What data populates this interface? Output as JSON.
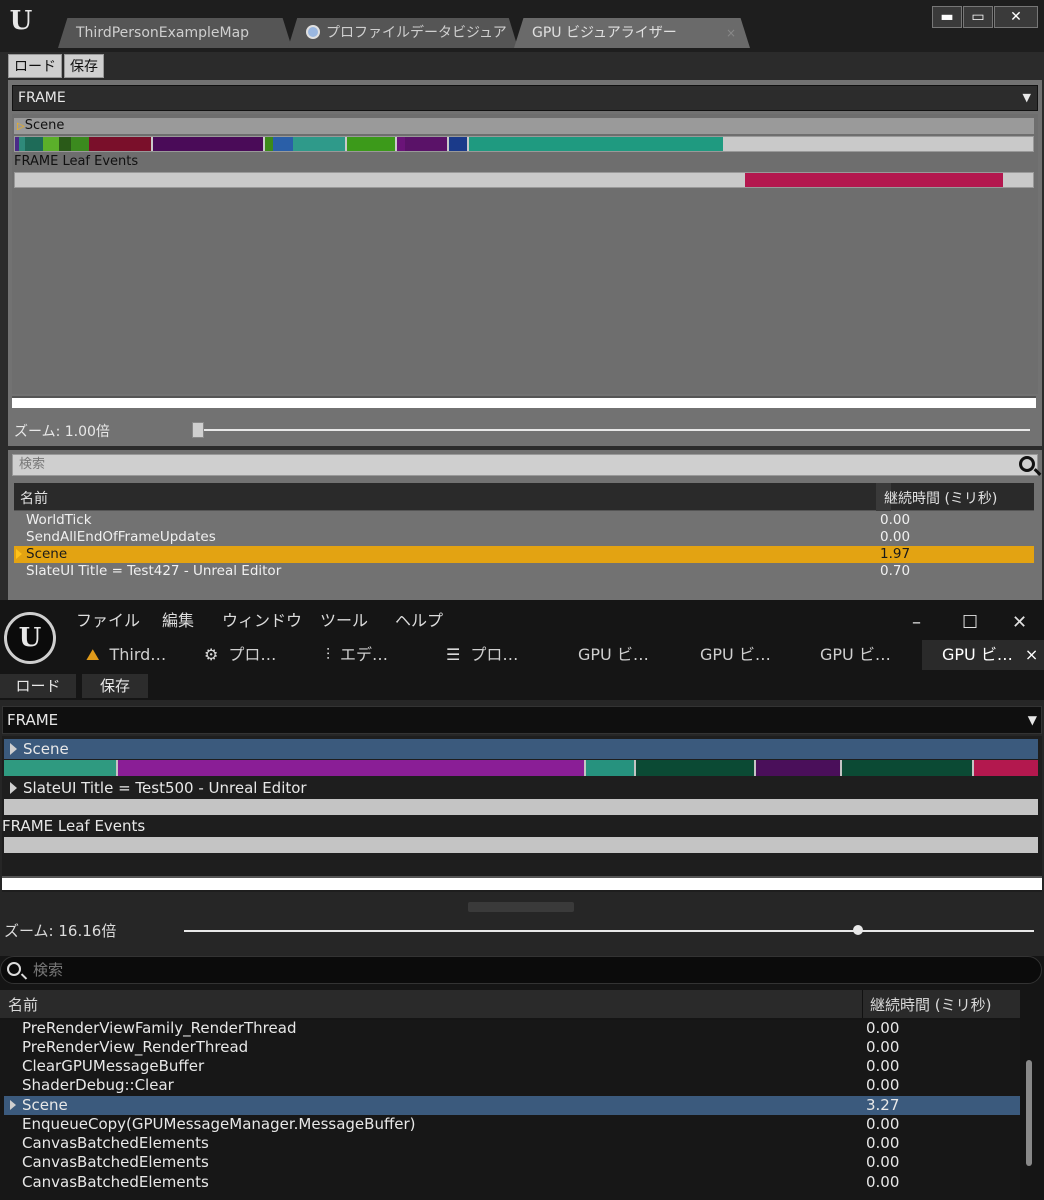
{
  "top_window": {
    "tabs": [
      {
        "label": "ThirdPersonExampleMap"
      },
      {
        "label": "プロファイルデータビジュア"
      },
      {
        "label": "GPU ビジュアライザー",
        "close": "×"
      }
    ],
    "window_controls": {
      "minimize": "▬",
      "maximize": "▭",
      "close": "✕"
    },
    "toolbar": {
      "load": "ロード",
      "save": "保存"
    },
    "frame_combo": "FRAME",
    "graph": {
      "row1_label": "Scene",
      "row2_label": "FRAME Leaf Events"
    },
    "zoom_label": "ズーム: 1.00倍",
    "zoom_value": 0.0,
    "search_placeholder": "検索",
    "table": {
      "headers": [
        "名前",
        "継続時間 (ミリ秒)"
      ],
      "rows": [
        {
          "name": "WorldTick",
          "value": "0.00"
        },
        {
          "name": "SendAllEndOfFrameUpdates",
          "value": "0.00"
        },
        {
          "name": "Scene",
          "value": "1.97",
          "selected": true
        },
        {
          "name": "SlateUI Title = Test427 - Unreal Editor",
          "value": "0.70"
        }
      ]
    }
  },
  "bottom_window": {
    "menu": [
      "ファイル",
      "編集",
      "ウィンドウ",
      "ツール",
      "ヘルプ"
    ],
    "window_controls": {
      "minimize": "–",
      "maximize": "☐",
      "close": "✕"
    },
    "tabs": [
      {
        "label": "Third…",
        "icon": "⛰"
      },
      {
        "label": "プロ…",
        "icon": "⚙"
      },
      {
        "label": "エデ…",
        "icon": "⫶"
      },
      {
        "label": "プロ…",
        "icon": "☰"
      },
      {
        "label": "GPU ビ…"
      },
      {
        "label": "GPU ビ…"
      },
      {
        "label": "GPU ビ…"
      },
      {
        "label": "GPU ビ…",
        "close": "×"
      }
    ],
    "toolbar": {
      "load": "ロード",
      "save": "保存"
    },
    "frame_combo": "FRAME",
    "graph": {
      "row1_label": "Scene",
      "row2_label": "SlateUI Title = Test500 - Unreal Editor",
      "row3_label": "FRAME Leaf Events"
    },
    "zoom_label": "ズーム: 16.16倍",
    "zoom_value": 0.81,
    "search_placeholder": "検索",
    "table": {
      "headers": [
        "名前",
        "継続時間 (ミリ秒)"
      ],
      "rows": [
        {
          "name": "PreRenderViewFamily_RenderThread",
          "value": "0.00"
        },
        {
          "name": "PreRenderView_RenderThread",
          "value": "0.00"
        },
        {
          "name": "ClearGPUMessageBuffer",
          "value": "0.00"
        },
        {
          "name": "ShaderDebug::Clear",
          "value": "0.00"
        },
        {
          "name": "Scene",
          "value": "3.27",
          "selected": true
        },
        {
          "name": "EnqueueCopy(GPUMessageManager.MessageBuffer)",
          "value": "0.00"
        },
        {
          "name": "CanvasBatchedElements",
          "value": "0.00"
        },
        {
          "name": "CanvasBatchedElements",
          "value": "0.00"
        },
        {
          "name": "CanvasBatchedElements",
          "value": "0.00"
        }
      ]
    }
  },
  "colors": {
    "ue4_selection": "#e3a312",
    "ue5_selection": "#3b5a7d"
  }
}
